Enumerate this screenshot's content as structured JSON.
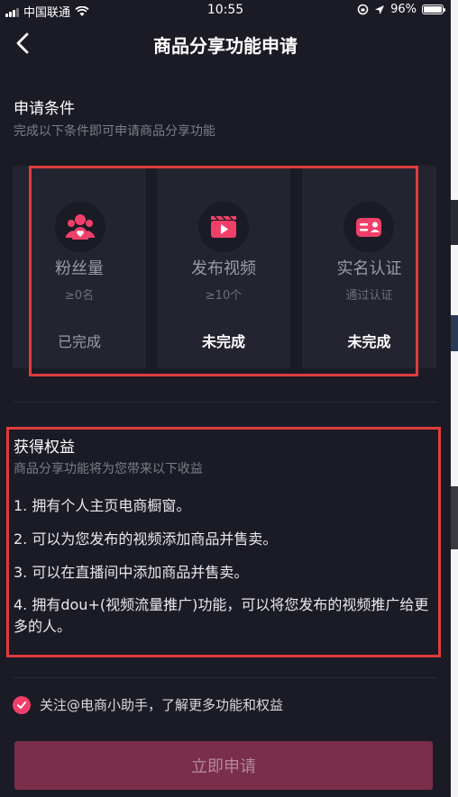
{
  "status_bar": {
    "carrier": "中国联通",
    "time": "10:55",
    "battery": "96%"
  },
  "nav": {
    "title": "商品分享功能申请"
  },
  "conditions": {
    "title": "申请条件",
    "subtitle": "完成以下条件即可申请商品分享功能",
    "cards": [
      {
        "icon": "fans-icon",
        "title": "粉丝量",
        "requirement": "≥0名",
        "status": "已完成"
      },
      {
        "icon": "video-icon",
        "title": "发布视频",
        "requirement": "≥10个",
        "status": "未完成"
      },
      {
        "icon": "id-card-icon",
        "title": "实名认证",
        "requirement": "通过认证",
        "status": "未完成"
      }
    ]
  },
  "benefits": {
    "title": "获得权益",
    "subtitle": "商品分享功能将为您带来以下收益",
    "items": [
      "1. 拥有个人主页电商橱窗。",
      "2. 可以为您发布的视频添加商品并售卖。",
      "3. 可以在直播间中添加商品并售卖。",
      "4. 拥有dou+(视频流量推广)功能，可以将您发布的视频推广给更多的人。"
    ]
  },
  "agreement": {
    "text": "关注@电商小助手，了解更多功能和权益",
    "checked": true
  },
  "apply_button": {
    "label": "立即申请"
  },
  "colors": {
    "background": "#1b1b25",
    "card": "#242430",
    "accent": "#f0406a",
    "highlight_box": "#e03c3c",
    "button": "#7a2e4a"
  }
}
